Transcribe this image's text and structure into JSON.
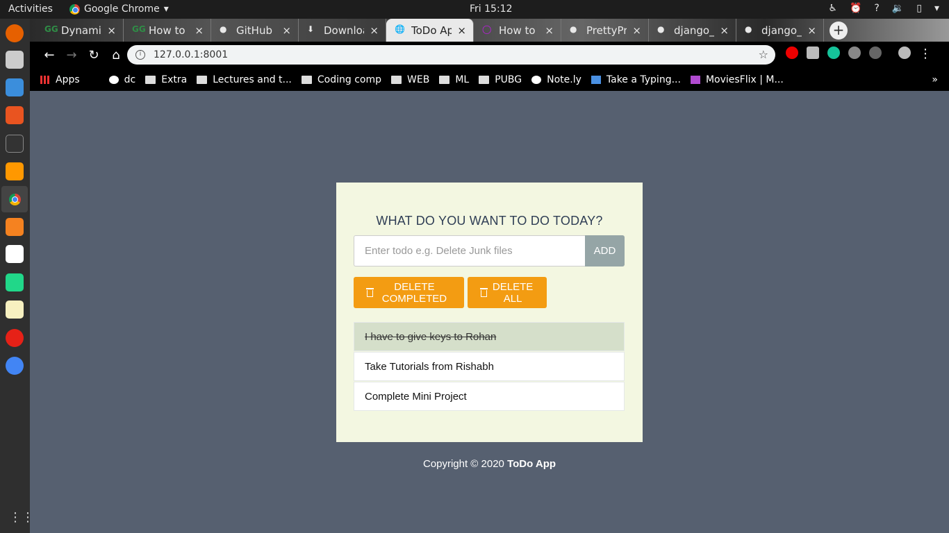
{
  "system": {
    "activities": "Activities",
    "app_name": "Google Chrome",
    "clock": "Fri 15:12"
  },
  "browser": {
    "tabs": [
      {
        "icon": "GG",
        "label": "Dynamic"
      },
      {
        "icon": "GG",
        "label": "How to s"
      },
      {
        "icon": "github-icon",
        "label": "GitHub"
      },
      {
        "icon": "download-icon",
        "label": "Downloa"
      },
      {
        "icon": "globe-icon",
        "label": "ToDo Ap"
      },
      {
        "icon": "circle-icon",
        "label": "How to S"
      },
      {
        "icon": "github-icon",
        "label": "PrettyPri"
      },
      {
        "icon": "github-icon",
        "label": "django_t"
      },
      {
        "icon": "github-icon",
        "label": "django_t"
      }
    ],
    "url": "127.0.0.1:8001",
    "bookmarks": [
      "Apps",
      "dc",
      "Extra",
      "Lectures and t...",
      "Coding comp",
      "WEB",
      "ML",
      "PUBG",
      "Note.ly",
      "Take a Typing...",
      "MoviesFlix | M..."
    ],
    "more": "»"
  },
  "app": {
    "title": "WHAT DO YOU WANT TO DO TODAY?",
    "input_placeholder": "Enter todo e.g. Delete Junk files",
    "add_label": "ADD",
    "delete_completed_label": "DELETE COMPLETED",
    "delete_all_label": "DELETE ALL",
    "todos": [
      {
        "text": "I have to give keys to Rohan",
        "done": true
      },
      {
        "text": "Take Tutorials from Rishabh",
        "done": false
      },
      {
        "text": "Complete Mini Project",
        "done": false
      }
    ],
    "footer_prefix": "Copyright © 2020 ",
    "footer_brand": "ToDo App"
  },
  "colors": {
    "background": "#566070",
    "card": "#f3f7e1",
    "warning": "#f39c12",
    "add_button": "#95a5a6",
    "done_item": "#d5dfca"
  }
}
